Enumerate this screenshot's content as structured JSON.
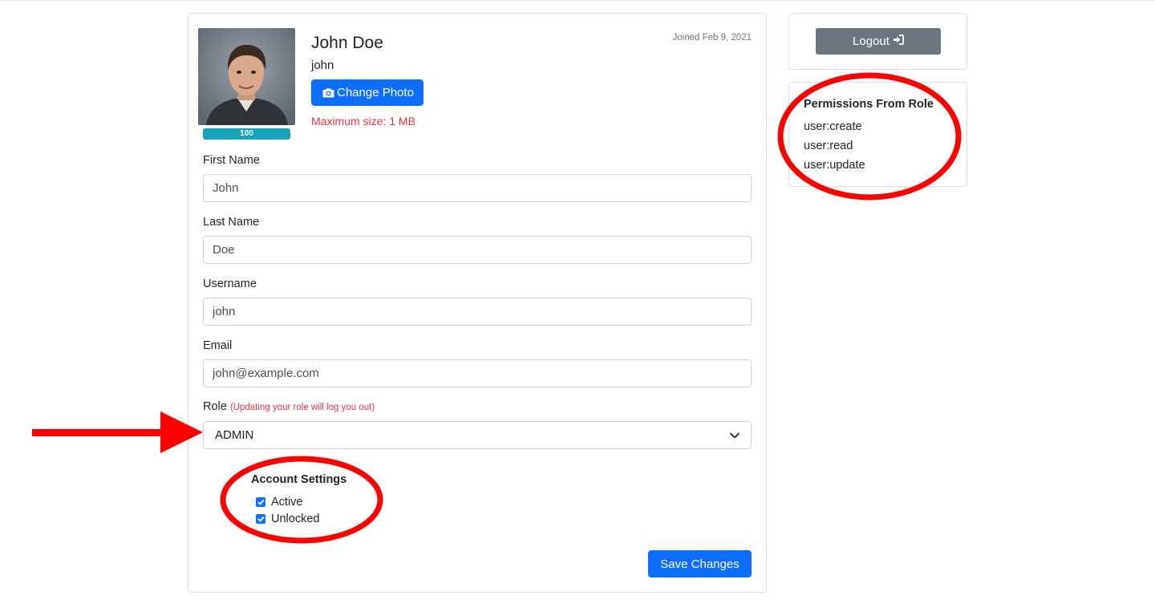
{
  "profile": {
    "name": "John Doe",
    "username": "john",
    "joined": "Joined Feb 9, 2021",
    "change_photo_label": "Change Photo",
    "max_size": "Maximum size: 1 MB",
    "upload_progress": "100",
    "upload_progress_percent": 100
  },
  "form": {
    "first_name": {
      "label": "First Name",
      "value": "John"
    },
    "last_name": {
      "label": "Last Name",
      "value": "Doe"
    },
    "username": {
      "label": "Username",
      "value": "john"
    },
    "email": {
      "label": "Email",
      "value": "john@example.com"
    },
    "role": {
      "label": "Role",
      "note": "(Updating your role will log you out)",
      "selected": "ADMIN"
    },
    "account_settings": {
      "title": "Account Settings",
      "active": {
        "label": "Active",
        "checked": true
      },
      "unlocked": {
        "label": "Unlocked",
        "checked": true
      }
    },
    "save_label": "Save Changes"
  },
  "sidebar": {
    "logout_label": "Logout",
    "permissions": {
      "title": "Permissions From Role",
      "items": [
        "user:create",
        "user:read",
        "user:update"
      ]
    }
  },
  "colors": {
    "primary": "#0d6efd",
    "secondary": "#6c757d",
    "danger": "#dc3545",
    "progress": "#17a2b8",
    "annotation": "#ff0000"
  },
  "icons": {
    "photo_button": "camera-icon",
    "logout_button": "sign-in-icon",
    "select": "chevron-down-icon"
  }
}
